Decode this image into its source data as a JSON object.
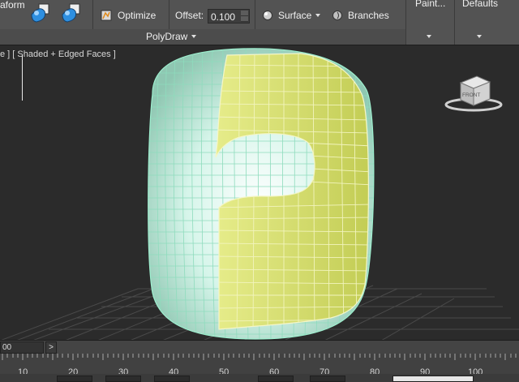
{
  "ribbon": {
    "transform_label": "aform",
    "optimize_label": "Optimize",
    "offset_label": "Offset:",
    "offset_value": "0.100",
    "surface_label": "Surface",
    "branches_label": "Branches",
    "paint_label": "Paint...",
    "defaults_label": "Defaults",
    "section_label": "PolyDraw"
  },
  "viewport": {
    "label": "e ] [ Shaded + Edged Faces ]",
    "viewcube_face": "FRONT"
  },
  "timeline": {
    "frame_field": "00",
    "next_label": ">",
    "ticks": [
      "10",
      "20",
      "30",
      "40",
      "50",
      "60",
      "70",
      "80",
      "90",
      "100"
    ]
  },
  "colors": {
    "ribbon_bg": "#535353",
    "viewport_bg": "#2b2b2b",
    "mesh_surface": "#c8efe0",
    "mesh_wire": "#9ff0d0",
    "selected_faces": "#d8e276"
  }
}
